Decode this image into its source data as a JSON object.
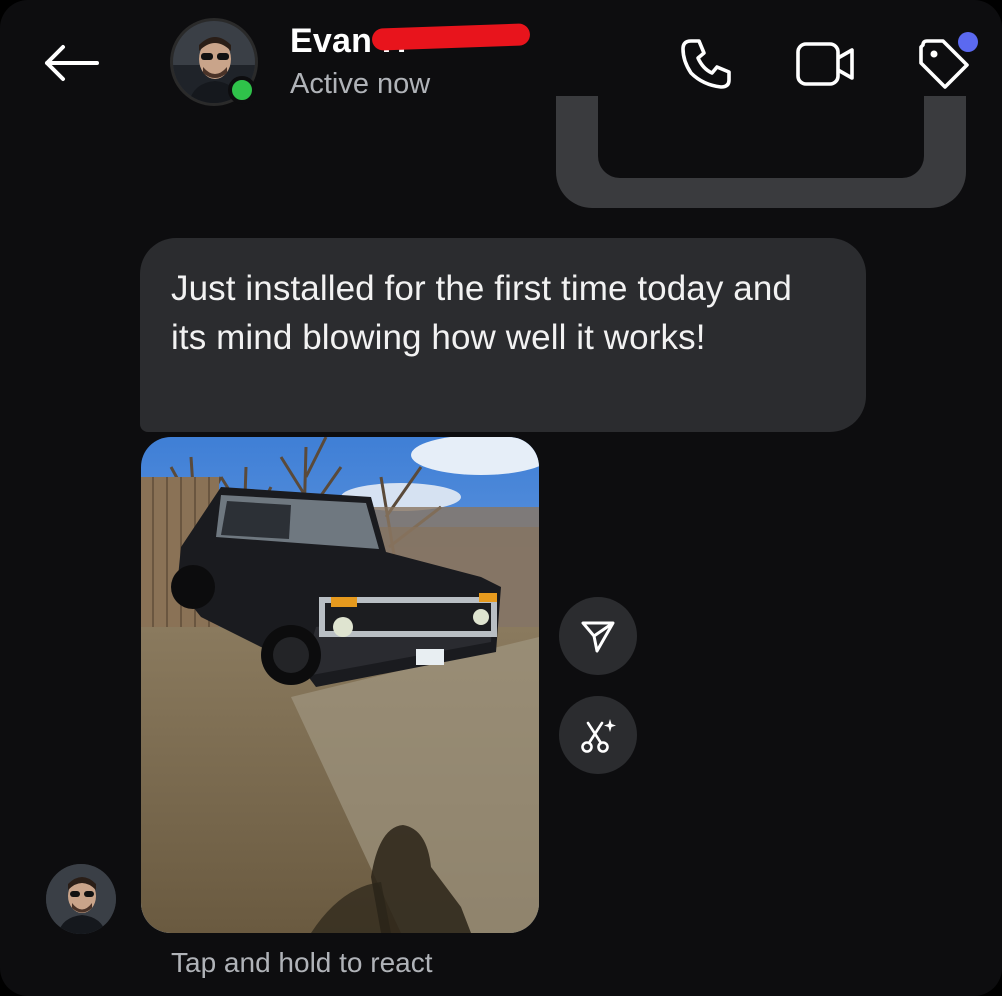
{
  "header": {
    "back_icon": "arrow-left-icon",
    "contact_name": "Evan H",
    "status": "Active now",
    "online_color": "#2fc24a",
    "call_icon": "phone-icon",
    "video_icon": "video-camera-icon",
    "tag_icon": "tag-icon",
    "notification_color": "#5b69f0"
  },
  "conversation": {
    "message_text": "Just installed for the first time today and its mind blowing how well it works!",
    "photo_icon": "photo-thumbnail",
    "share_icon": "send-icon",
    "remix_icon": "scissors-sparkle-icon",
    "react_hint": "Tap and hold to react"
  },
  "colors": {
    "background": "#0d0d0f",
    "bubble": "#2b2c2f",
    "redaction": "#e8141c"
  }
}
